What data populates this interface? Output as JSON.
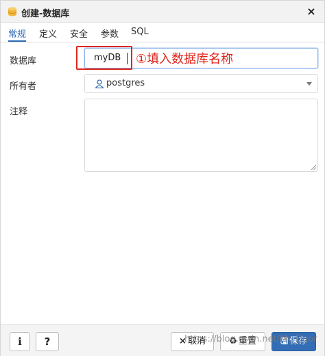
{
  "window": {
    "title": "创建-数据库",
    "close_glyph": "×"
  },
  "tabs": [
    {
      "label": "常规"
    },
    {
      "label": "定义"
    },
    {
      "label": "安全"
    },
    {
      "label": "参数"
    },
    {
      "label": "SQL"
    }
  ],
  "form": {
    "database_label": "数据库",
    "database_value": "myDB",
    "owner_label": "所有者",
    "owner_value": "postgres",
    "comment_label": "注释",
    "comment_value": ""
  },
  "annotation": {
    "text": "①填入数据库名称",
    "color": "#e0241b"
  },
  "footer": {
    "info_label": "i",
    "help_label": "?",
    "cancel_icon": "×",
    "cancel_label": "取消",
    "reset_icon": "♻",
    "reset_label": "重置",
    "save_icon": "🖫",
    "save_label": "保存"
  },
  "watermark": "https://blog.csdn.net/Mr_Door",
  "colors": {
    "accent": "#326db6",
    "tab_active": "#2a6ab3",
    "annotation": "#e0241b"
  }
}
